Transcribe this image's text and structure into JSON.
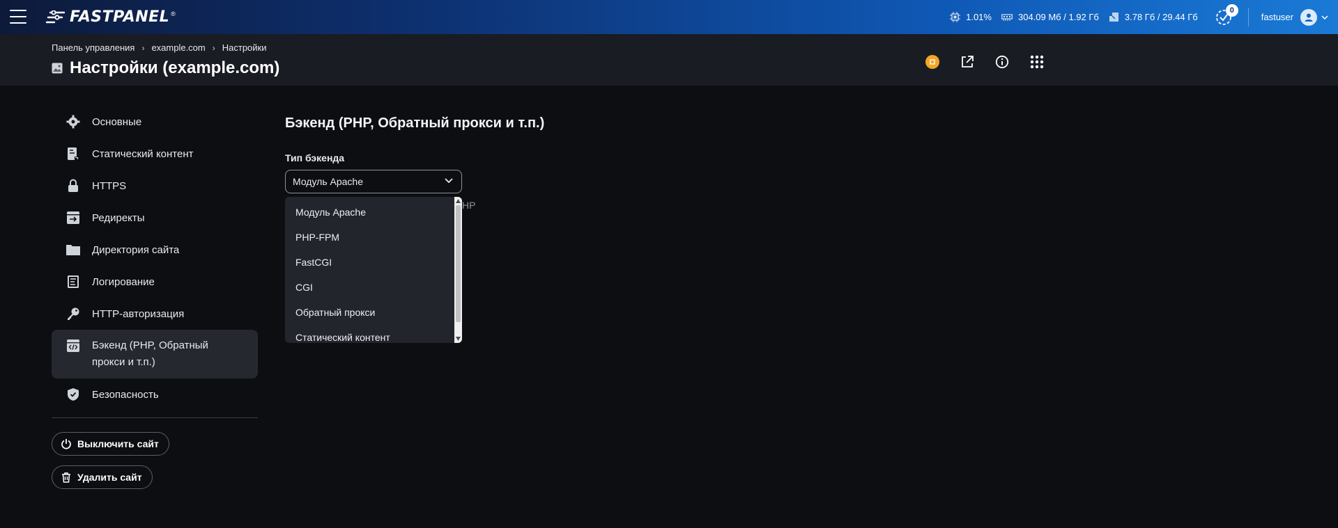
{
  "topbar": {
    "logo_text": "FASTPANEL",
    "logo_reg": "®",
    "cpu": "1.01%",
    "memory": "304.09 Мб / 1.92 Гб",
    "disk": "3.78 Гб / 29.44 Гб",
    "tasks_count": "0",
    "username": "fastuser"
  },
  "header": {
    "breadcrumb": [
      "Панель управления",
      "example.com",
      "Настройки"
    ],
    "title": "Настройки (example.com)"
  },
  "sidebar": {
    "items": [
      {
        "label": "Основные",
        "icon": "gear-icon"
      },
      {
        "label": "Статический контент",
        "icon": "file-icon"
      },
      {
        "label": "HTTPS",
        "icon": "lock-icon"
      },
      {
        "label": "Редиректы",
        "icon": "redirect-icon"
      },
      {
        "label": "Директория сайта",
        "icon": "folder-icon"
      },
      {
        "label": "Логирование",
        "icon": "log-icon"
      },
      {
        "label": "HTTP-авторизация",
        "icon": "key-icon"
      },
      {
        "label": "Бэкенд (PHP, Обратный прокси и т.п.)",
        "icon": "code-window-icon",
        "active": true
      },
      {
        "label": "Безопасность",
        "icon": "shield-icon"
      }
    ],
    "disable_site_label": "Выключить сайт",
    "delete_site_label": "Удалить сайт"
  },
  "content": {
    "section_title": "Бэкенд (PHP, Обратный прокси и т.п.)",
    "backend_type_label": "Тип бэкенда",
    "backend_type_value": "Модуль Apache",
    "behind_text": "HP",
    "dropdown_options": [
      "Модуль Apache",
      "PHP-FPM",
      "FastCGI",
      "CGI",
      "Обратный прокси",
      "Статический контент"
    ]
  },
  "colors": {
    "accent_blue": "#0f58b5",
    "coin_orange": "#f5a623",
    "background": "#0d0e12"
  }
}
